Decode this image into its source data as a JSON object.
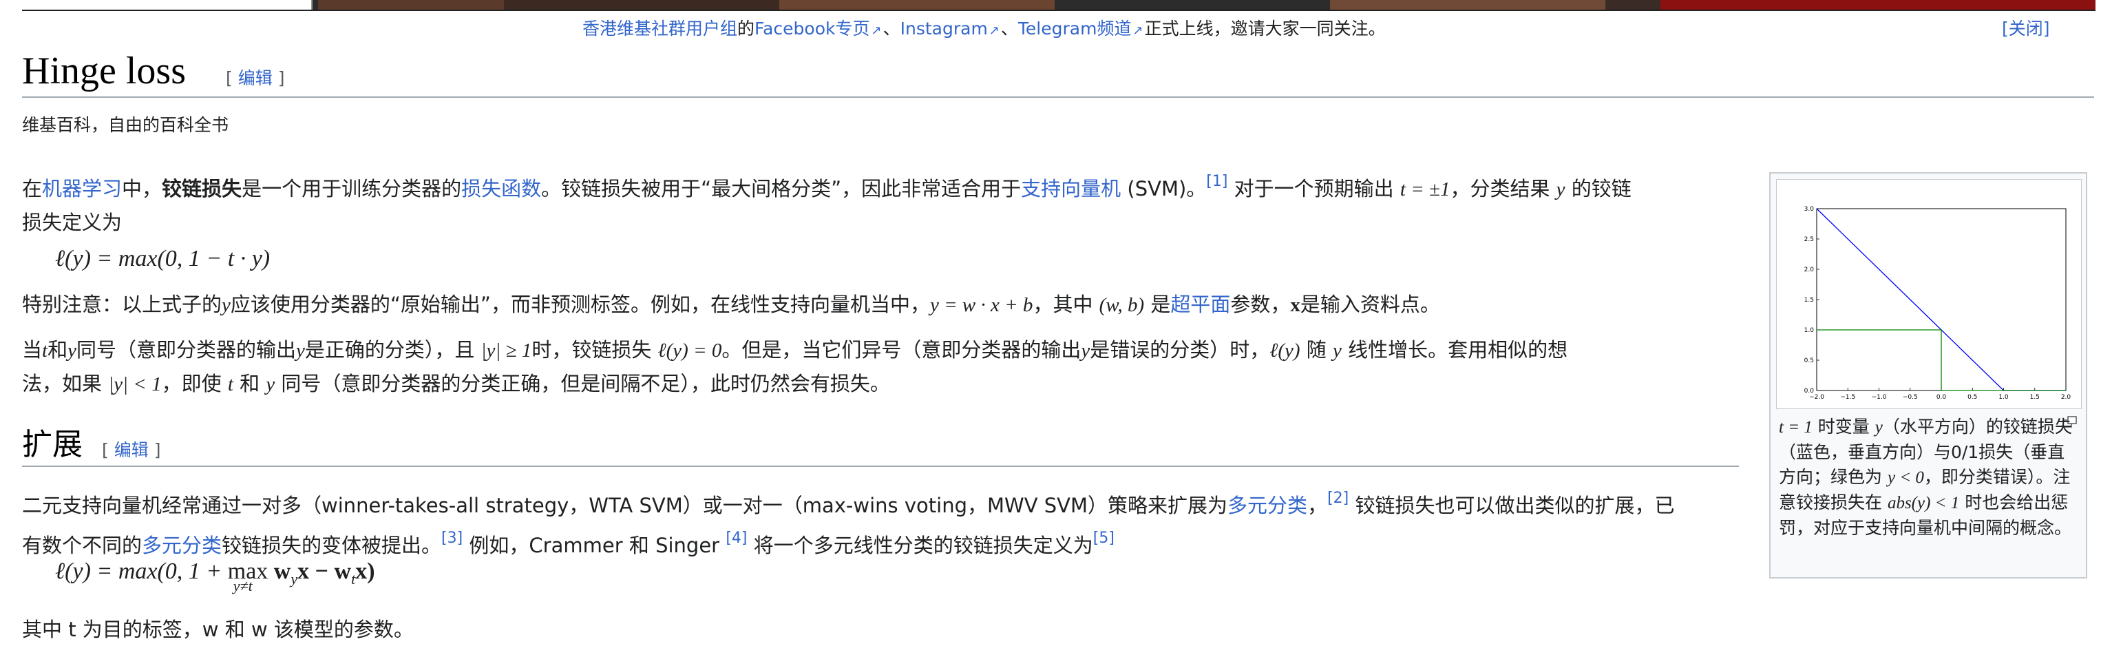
{
  "notice": {
    "prefix_link": "香港维基社群用户组",
    "text1": "的",
    "facebook": "Facebook专页",
    "sep1": "、",
    "instagram": "Instagram",
    "sep2": "、",
    "telegram": "Telegram频道",
    "suffix": "正式上线，邀请大家一同关注。",
    "close": "[关闭]"
  },
  "page": {
    "title": "Hinge loss",
    "edit_open": "[",
    "edit_label": "编辑",
    "edit_close": "]",
    "tagline": "维基百科，自由的百科全书"
  },
  "intro": {
    "a1": "在",
    "link_ml": "机器学习",
    "a2": "中，",
    "bold": "铰链损失",
    "a3": "是一个用于训练分类器的",
    "link_loss": "损失函数",
    "a4": "。铰链损失被用于“最大间格分类”，因此非常适合用于",
    "link_svm": "支持向量机",
    "a5": " (SVM)。",
    "ref1": "[1]",
    "a6": " 对于一个预期输出 ",
    "m1": "t = ±1",
    "a7": "，分类结果 ",
    "m2": "y",
    "a8": " 的铰链",
    "a9": "损失定义为"
  },
  "eq1": "ℓ(y) = max(0, 1 − t · y)",
  "p2": {
    "a1": "特别注意：以上式子的",
    "m1": "y",
    "a2": "应该使用分类器的“原始输出”，而非预测标签。例如，在线性支持向量机当中，",
    "m2": "y = w · x + b",
    "a3": "，其中 ",
    "m3": "(w, b)",
    "a4": " 是",
    "link_hyper": "超平面",
    "a5": "参数，",
    "m4": "x",
    "a6": "是输入资料点。"
  },
  "p3": {
    "a1": "当",
    "m1": "t",
    "a2": "和",
    "m2": "y",
    "a3": "同号（意即分类器的输出",
    "m3": "y",
    "a4": "是正确的分类），且 ",
    "m4": "|y| ≥ 1",
    "a5": "时，铰链损失 ",
    "m5": "ℓ(y) = 0",
    "a6": "。但是，当它们异号（意即分类器的输出",
    "m6": "y",
    "a7": "是错误的分类）时，",
    "m7": "ℓ(y)",
    "a8": " 随 ",
    "m8": "y",
    "a9": " 线性增长。套用相似的想",
    "b1": "法，如果 ",
    "m9": "|y| < 1",
    "b2": "，即使 ",
    "m10": "t",
    "b3": " 和 ",
    "m11": "y",
    "b4": " 同号（意即分类器的分类正确，但是间隔不足），此时仍然会有损失。"
  },
  "section": {
    "title": "扩展",
    "edit_open": "[",
    "edit_label": "编辑",
    "edit_close": "]"
  },
  "p4": {
    "a1": "二元支持向量机经常通过一对多（winner-takes-all strategy，WTA SVM）或一对一（max-wins voting，MWV SVM）策略来扩展为",
    "link_multi": "多元分类",
    "a2": "，",
    "ref2": "[2]",
    "a3": " 铰链损失也可以做出类似的扩展，已",
    "b1": "有数个不同的",
    "link_multi2": "多元分类",
    "b2": "铰链损失的变体被提出。",
    "ref3": "[3]",
    "b3": " 例如，Crammer 和 Singer ",
    "ref4": "[4]",
    "b4": " 将一个多元线性分类的铰链损失定义为",
    "ref5": "[5]"
  },
  "eq2": {
    "lhs": "ℓ(y) = max(0, 1 + ",
    "max": "max",
    "sub": "y≠t",
    "rhs": " w",
    "rhs_sub1": "y",
    "rhs2": "x − w",
    "rhs_sub2": "t",
    "rhs3": "x)"
  },
  "cutoff_line": "其中 t 为目的标签，w 和 w 该模型的参数。",
  "thumb": {
    "caption_a": "t = 1",
    "caption_b": " 时变量 ",
    "caption_m": "y",
    "caption_c": "（水平方向）的铰链损失（蓝色，垂直方向）与0/1损失（垂直方向；绿色为 ",
    "caption_m2": "y < 0",
    "caption_d": "，即分类错误）。注意铰接损失在 ",
    "caption_m3": "abs(y) < 1",
    "caption_e": " 时也会给出惩罚，对应于支持向量机中间隔的概念。"
  },
  "chart_data": {
    "type": "line",
    "xlim": [
      -2.0,
      2.0
    ],
    "ylim": [
      0.0,
      3.0
    ],
    "xticks": [
      "−2.0",
      "−1.5",
      "−1.0",
      "−0.5",
      "0.0",
      "0.5",
      "1.0",
      "1.5",
      "2.0"
    ],
    "yticks": [
      "0.0",
      "0.5",
      "1.0",
      "1.5",
      "2.0",
      "2.5",
      "3.0"
    ],
    "series": [
      {
        "color": "#0000ff",
        "x": [
          -2.0,
          1.0,
          2.0
        ],
        "y": [
          3.0,
          0.0,
          0.0
        ]
      },
      {
        "color": "#008000",
        "x": [
          -2.0,
          0.0,
          0.0,
          2.0
        ],
        "y": [
          1.0,
          1.0,
          0.0,
          0.0
        ]
      }
    ]
  }
}
